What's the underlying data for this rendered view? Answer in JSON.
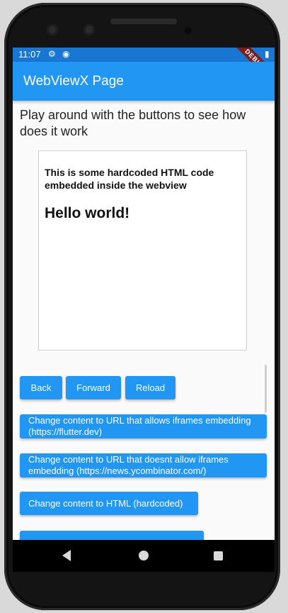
{
  "status_bar": {
    "time": "11:07",
    "debug_label": "DEBUG"
  },
  "app_bar": {
    "title": "WebViewX Page"
  },
  "intro_text": "Play around with the buttons to see how does it work",
  "webview": {
    "paragraph": "This is some hardcoded HTML code embedded inside the webview",
    "heading": "Hello world!"
  },
  "buttons": {
    "back": "Back",
    "forward": "Forward",
    "reload": "Reload",
    "url_iframes": "Change content to URL that allows iframes embedding (https://flutter.dev)",
    "url_no_iframes": "Change content to URL that doesnt allow iframes embedding (https://news.ycombinator.com/)",
    "html_hardcoded": "Change content to HTML (hardcoded)"
  },
  "colors": {
    "primary": "#2196f3",
    "status_bar": "#1976d2"
  }
}
